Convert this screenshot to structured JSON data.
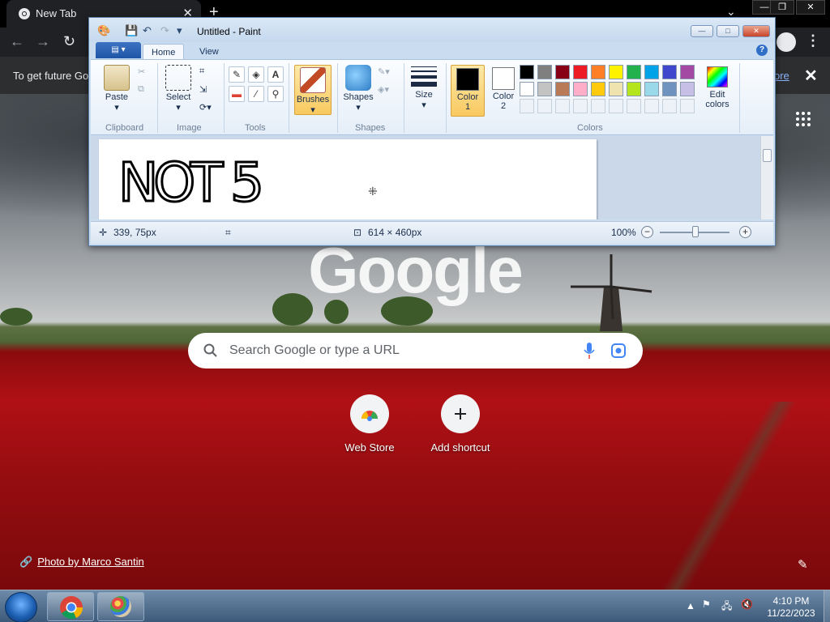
{
  "chrome": {
    "tab_title": "New Tab",
    "infobar_text": "To get future Go",
    "infobar_link": "ore"
  },
  "ntp": {
    "logo": "Google",
    "search_placeholder": "Search Google or type a URL",
    "shortcuts": [
      {
        "label": "Web Store"
      },
      {
        "label": "Add shortcut"
      }
    ],
    "photo_credit": "Photo by Marco Santin"
  },
  "paint": {
    "title": "Untitled - Paint",
    "tabs": [
      "Home",
      "View"
    ],
    "groups": {
      "clipboard": "Clipboard",
      "image": "Image",
      "tools": "Tools",
      "shapes": "Shapes",
      "colors": "Colors"
    },
    "buttons": {
      "paste": "Paste",
      "select": "Select",
      "brushes": "Brushes",
      "shapes": "Shapes",
      "size": "Size",
      "color1_line1": "Color",
      "color1_line2": "1",
      "color2_line1": "Color",
      "color2_line2": "2",
      "edit_colors_line1": "Edit",
      "edit_colors_line2": "colors"
    },
    "drawn_text": "NOT   5",
    "status": {
      "cursor_pos": "339, 75px",
      "canvas_size": "614 × 460px",
      "zoom": "100%"
    },
    "colors": {
      "color1": "#000000",
      "color2": "#ffffff",
      "palette_row1": [
        "#000000",
        "#7f7f7f",
        "#880015",
        "#ed1c24",
        "#ff7f27",
        "#fff200",
        "#22b14c",
        "#00a2e8",
        "#3f48cc",
        "#a349a4"
      ],
      "palette_row2": [
        "#ffffff",
        "#c3c3c3",
        "#b97a57",
        "#ffaec9",
        "#ffc90e",
        "#efe4b0",
        "#b5e61d",
        "#99d9ea",
        "#7092be",
        "#c8bfe7"
      ]
    }
  },
  "taskbar": {
    "time": "4:10 PM",
    "date": "11/22/2023"
  }
}
